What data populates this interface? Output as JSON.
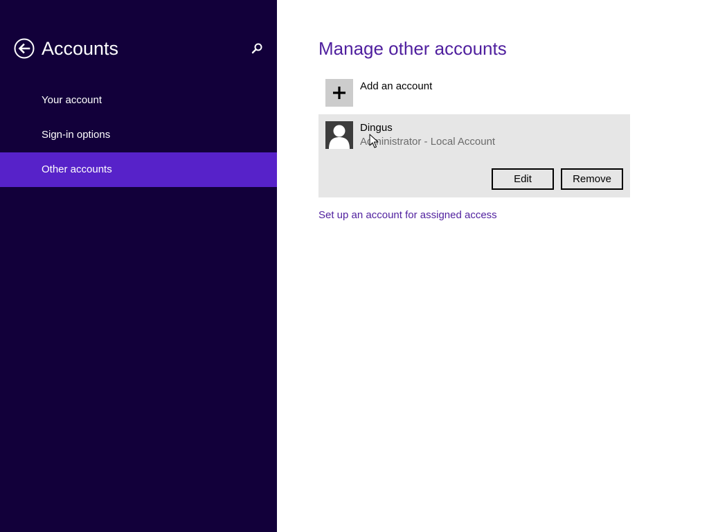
{
  "colors": {
    "left_pane_bg": "#12003a",
    "selected_nav_bg": "#5722c9",
    "accent": "#4f1f9e",
    "card_bg": "#e6e6e6"
  },
  "left_pane": {
    "title": "Accounts",
    "back_icon": "back-arrow-circle-icon",
    "search_icon": "search-icon",
    "nav_items": [
      {
        "label": "Your account",
        "selected": false
      },
      {
        "label": "Sign-in options",
        "selected": false
      },
      {
        "label": "Other accounts",
        "selected": true
      }
    ]
  },
  "main": {
    "title": "Manage other accounts",
    "add_account": {
      "icon": "plus-icon",
      "label": "Add an account"
    },
    "accounts": [
      {
        "name": "Dingus",
        "type": "Administrator - Local Account",
        "avatar_icon": "user-silhouette-icon",
        "edit_label": "Edit",
        "remove_label": "Remove"
      }
    ],
    "assigned_access_link": "Set up an account for assigned access"
  }
}
